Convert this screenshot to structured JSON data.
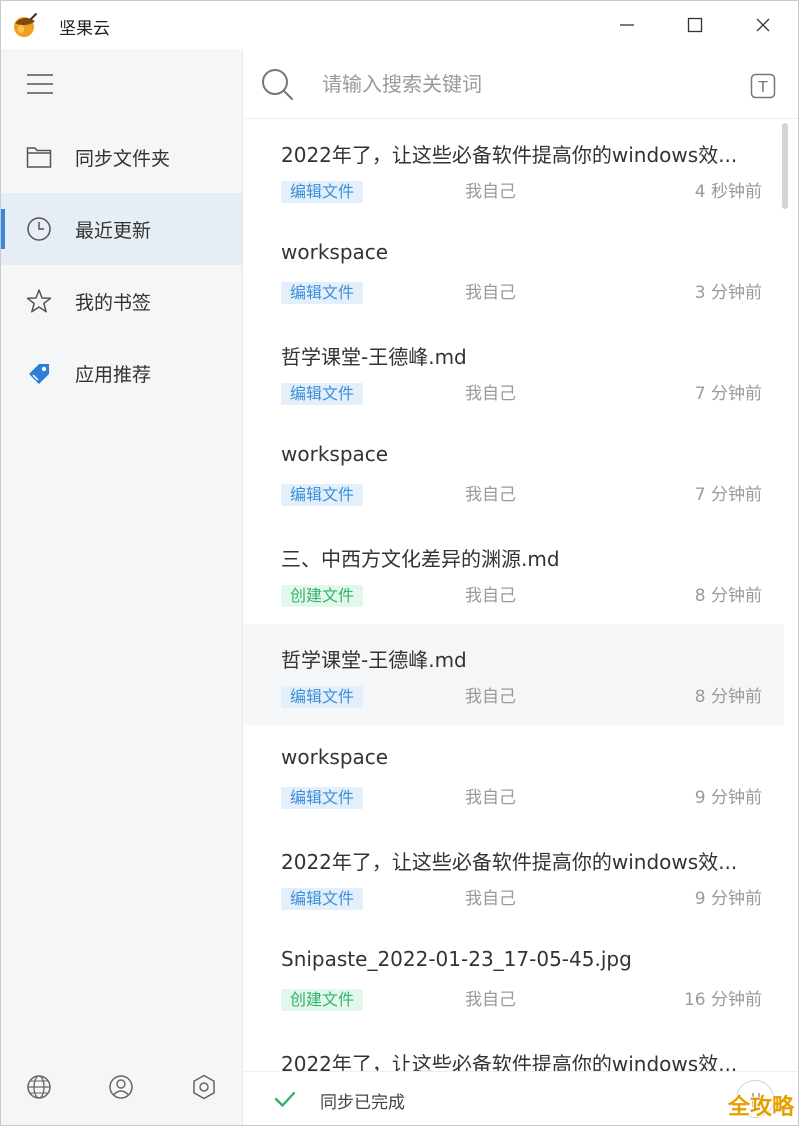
{
  "window": {
    "title": "坚果云",
    "controls": {
      "minimize_icon": "minimize-icon",
      "maximize_icon": "maximize-icon",
      "close_icon": "close-icon"
    }
  },
  "sidebar": {
    "menu_icon": "hamburger-icon",
    "items": [
      {
        "label": "同步文件夹",
        "icon": "folder-icon",
        "active": false
      },
      {
        "label": "最近更新",
        "icon": "clock-icon",
        "active": true
      },
      {
        "label": "我的书签",
        "icon": "star-icon",
        "active": false
      },
      {
        "label": "应用推荐",
        "icon": "tag-icon",
        "active": false
      }
    ],
    "bottom_icons": [
      "globe-icon",
      "user-icon",
      "settings-icon"
    ]
  },
  "search": {
    "placeholder": "请输入搜索关键词",
    "value": "",
    "toggle_label": "T"
  },
  "recent": [
    {
      "title": "2022年了，让这些必备软件提高你的windows效...",
      "tag": "编辑文件",
      "tag_type": "edit",
      "user": "我自己",
      "time": "4 秒钟前"
    },
    {
      "title": "workspace",
      "tag": "编辑文件",
      "tag_type": "edit",
      "user": "我自己",
      "time": "3 分钟前"
    },
    {
      "title": "哲学课堂-王德峰.md",
      "tag": "编辑文件",
      "tag_type": "edit",
      "user": "我自己",
      "time": "7 分钟前"
    },
    {
      "title": "workspace",
      "tag": "编辑文件",
      "tag_type": "edit",
      "user": "我自己",
      "time": "7 分钟前"
    },
    {
      "title": "三、中西方文化差异的渊源.md",
      "tag": "创建文件",
      "tag_type": "create",
      "user": "我自己",
      "time": "8 分钟前"
    },
    {
      "title": "哲学课堂-王德峰.md",
      "tag": "编辑文件",
      "tag_type": "edit",
      "user": "我自己",
      "time": "8 分钟前",
      "selected": true
    },
    {
      "title": "workspace",
      "tag": "编辑文件",
      "tag_type": "edit",
      "user": "我自己",
      "time": "9 分钟前"
    },
    {
      "title": "2022年了，让这些必备软件提高你的windows效...",
      "tag": "编辑文件",
      "tag_type": "edit",
      "user": "我自己",
      "time": "9 分钟前"
    },
    {
      "title": "Snipaste_2022-01-23_17-05-45.jpg",
      "tag": "创建文件",
      "tag_type": "create",
      "user": "我自己",
      "time": "16 分钟前"
    },
    {
      "title": "2022年了，让这些必备软件提高你的windows效...",
      "tag": "",
      "tag_type": "",
      "user": "",
      "time": ""
    }
  ],
  "status": {
    "text": "同步已完成",
    "icon": "check-icon"
  },
  "watermark": "全攻略",
  "colors": {
    "accent": "#3a86e0",
    "edit_tag": "#3d8fd8",
    "create_tag": "#34b36b",
    "check": "#2fb36b"
  }
}
